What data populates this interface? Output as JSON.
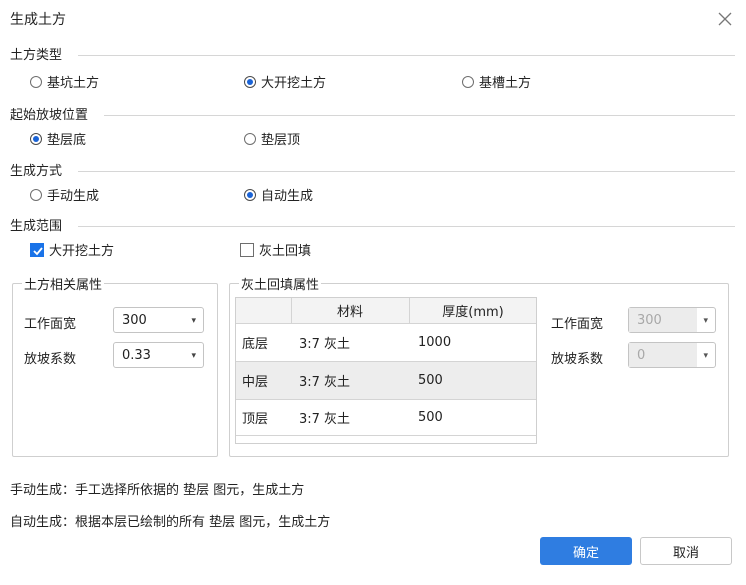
{
  "dialog": {
    "title": "生成土方",
    "close_icon": "close-icon"
  },
  "earthwork_type": {
    "label": "土方类型",
    "options": [
      "基坑土方",
      "大开挖土方",
      "基槽土方"
    ],
    "selected": "大开挖土方"
  },
  "slope_start": {
    "label": "起始放坡位置",
    "options": [
      "垫层底",
      "垫层顶"
    ],
    "selected": "垫层底"
  },
  "generation_method": {
    "label": "生成方式",
    "options": [
      "手动生成",
      "自动生成"
    ],
    "selected": "自动生成"
  },
  "generation_scope": {
    "label": "生成范围",
    "checkboxes": [
      {
        "label": "大开挖土方",
        "checked": true
      },
      {
        "label": "灰土回填",
        "checked": false
      }
    ]
  },
  "earth_props": {
    "title": "土方相关属性",
    "work_width_label": "工作面宽",
    "work_width_value": "300",
    "slope_coef_label": "放坡系数",
    "slope_coef_value": "0.33"
  },
  "backfill_props": {
    "title": "灰土回填属性",
    "table": {
      "headers": [
        "",
        "材料",
        "厚度(mm)"
      ],
      "rows": [
        {
          "layer": "底层",
          "material": "3:7 灰土",
          "thickness": "1000"
        },
        {
          "layer": "中层",
          "material": "3:7 灰土",
          "thickness": "500"
        },
        {
          "layer": "顶层",
          "material": "3:7 灰土",
          "thickness": "500"
        }
      ]
    },
    "work_width_label": "工作面宽",
    "work_width_value": "300",
    "slope_coef_label": "放坡系数",
    "slope_coef_value": "0"
  },
  "notes": {
    "manual": "手动生成：手工选择所依据的 垫层 图元，生成土方",
    "auto": "自动生成：根据本层已绘制的所有 垫层 图元，生成土方"
  },
  "buttons": {
    "ok": "确定",
    "cancel": "取消"
  },
  "colors": {
    "primary": "#2f7de1",
    "checkbox": "#1a73e8",
    "radio_dot": "#1a63d6"
  }
}
